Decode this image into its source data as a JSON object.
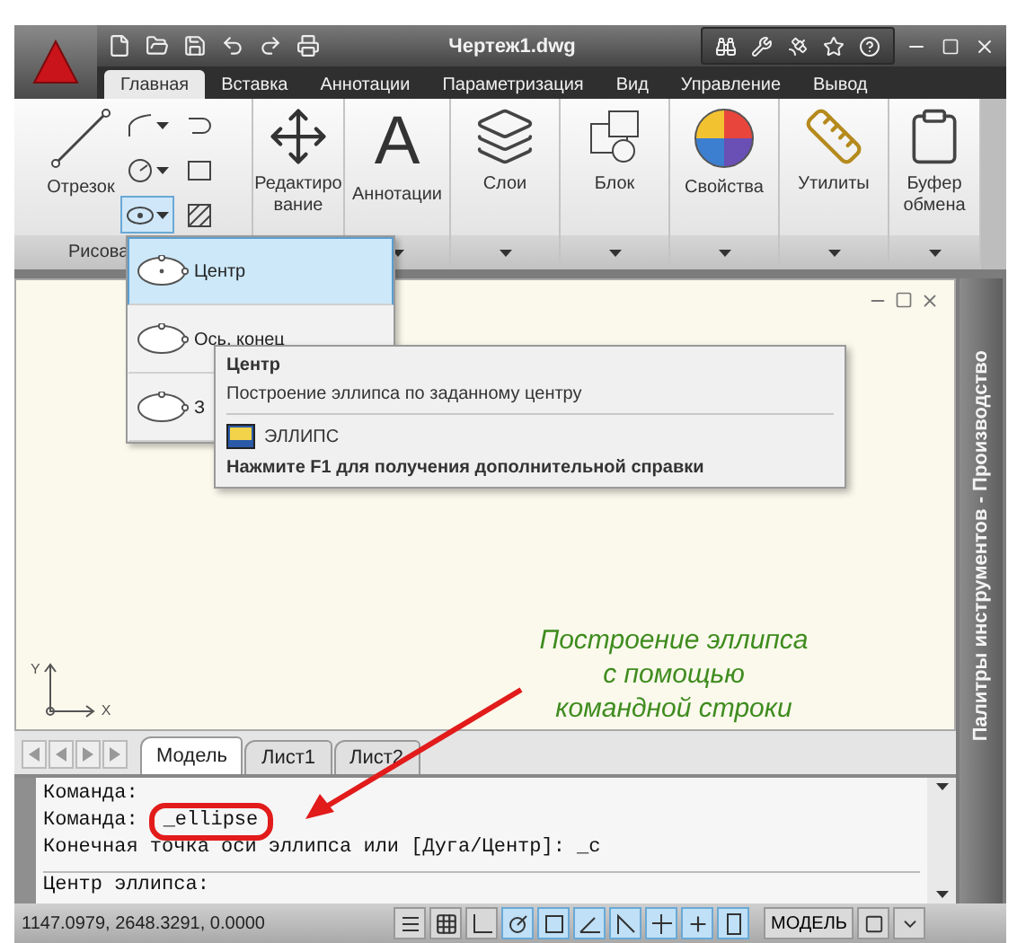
{
  "title_bar": {
    "title": "Чертеж1.dwg"
  },
  "ribbon_tabs": [
    {
      "label": "Главная",
      "selected": true
    },
    {
      "label": "Вставка",
      "selected": false
    },
    {
      "label": "Аннотации",
      "selected": false
    },
    {
      "label": "Параметризация",
      "selected": false
    },
    {
      "label": "Вид",
      "selected": false
    },
    {
      "label": "Управление",
      "selected": false
    },
    {
      "label": "Вывод",
      "selected": false
    }
  ],
  "draw_panel": {
    "big_button": "Отрезок",
    "footer": "Рисова"
  },
  "ribbon_panels": [
    {
      "kind": "move",
      "label": "Редактиро\nвание"
    },
    {
      "kind": "glyph",
      "glyph": "A",
      "label": "Аннотации"
    },
    {
      "kind": "layers",
      "label": "Слои"
    },
    {
      "kind": "block",
      "label": "Блок"
    },
    {
      "kind": "properties",
      "label": "Свойства"
    },
    {
      "kind": "utilities",
      "label": "Утилиты"
    },
    {
      "kind": "clipboard",
      "label": "Буфер\nобмена"
    }
  ],
  "ellipse_menu": [
    {
      "label": "Центр",
      "selected": true
    },
    {
      "label": "Ось, конец",
      "selected": false
    },
    {
      "label": "З",
      "selected": false
    }
  ],
  "tooltip": {
    "title": "Центр",
    "description": "Построение эллипса по заданному центру",
    "command": "ЭЛЛИПС",
    "help": "Нажмите F1 для получения дополнительной справки"
  },
  "ucs": {
    "x_label": "X",
    "y_label": "Y"
  },
  "annotation": "Построение эллипса\nс помощью\nкомандной строки",
  "layout_tabs": [
    {
      "label": "Модель",
      "selected": true
    },
    {
      "label": "Лист1",
      "selected": false
    },
    {
      "label": "Лист2",
      "selected": false
    }
  ],
  "command_lines": [
    {
      "text": "Команда:"
    },
    {
      "text": "Команда:",
      "input": "_ellipse",
      "highlighted": true
    },
    {
      "text": "Конечная точка оси эллипса или [Дуга/Центр]: _c"
    }
  ],
  "command_prompt": "Центр эллипса:",
  "palette": "Палитры инструментов - Производство",
  "status_bar": {
    "coordinates": "1147.0979, 2648.3291, 0.0000",
    "toggles": [
      {
        "on": false
      },
      {
        "on": false
      },
      {
        "on": false
      },
      {
        "on": true
      },
      {
        "on": true
      },
      {
        "on": true
      },
      {
        "on": true
      },
      {
        "on": true
      },
      {
        "on": true
      },
      {
        "on": true
      }
    ],
    "space": "МОДЕЛЬ"
  }
}
